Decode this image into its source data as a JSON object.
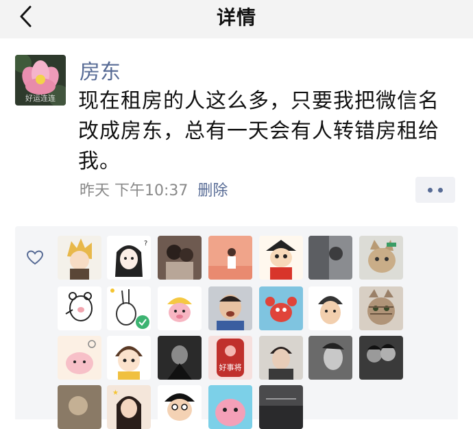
{
  "header": {
    "title": "详情",
    "back_icon": "chevron-left-icon"
  },
  "post": {
    "avatar_caption": "好运连连",
    "username": "房东",
    "content": "现在租房的人这么多，只要我把微信名改成房东，总有一天会有人转错房租给我。",
    "time": "昨天 下午10:37",
    "delete_label": "删除",
    "more_icon": "two-dots-icon"
  },
  "likes": {
    "heart_icon": "heart-outline-icon",
    "avatar_labels": {
      "r3c4": "好事将"
    }
  },
  "colors": {
    "link": "#576b95",
    "header_bg": "#f3f3f3",
    "likes_bg": "#f4f5f7"
  }
}
